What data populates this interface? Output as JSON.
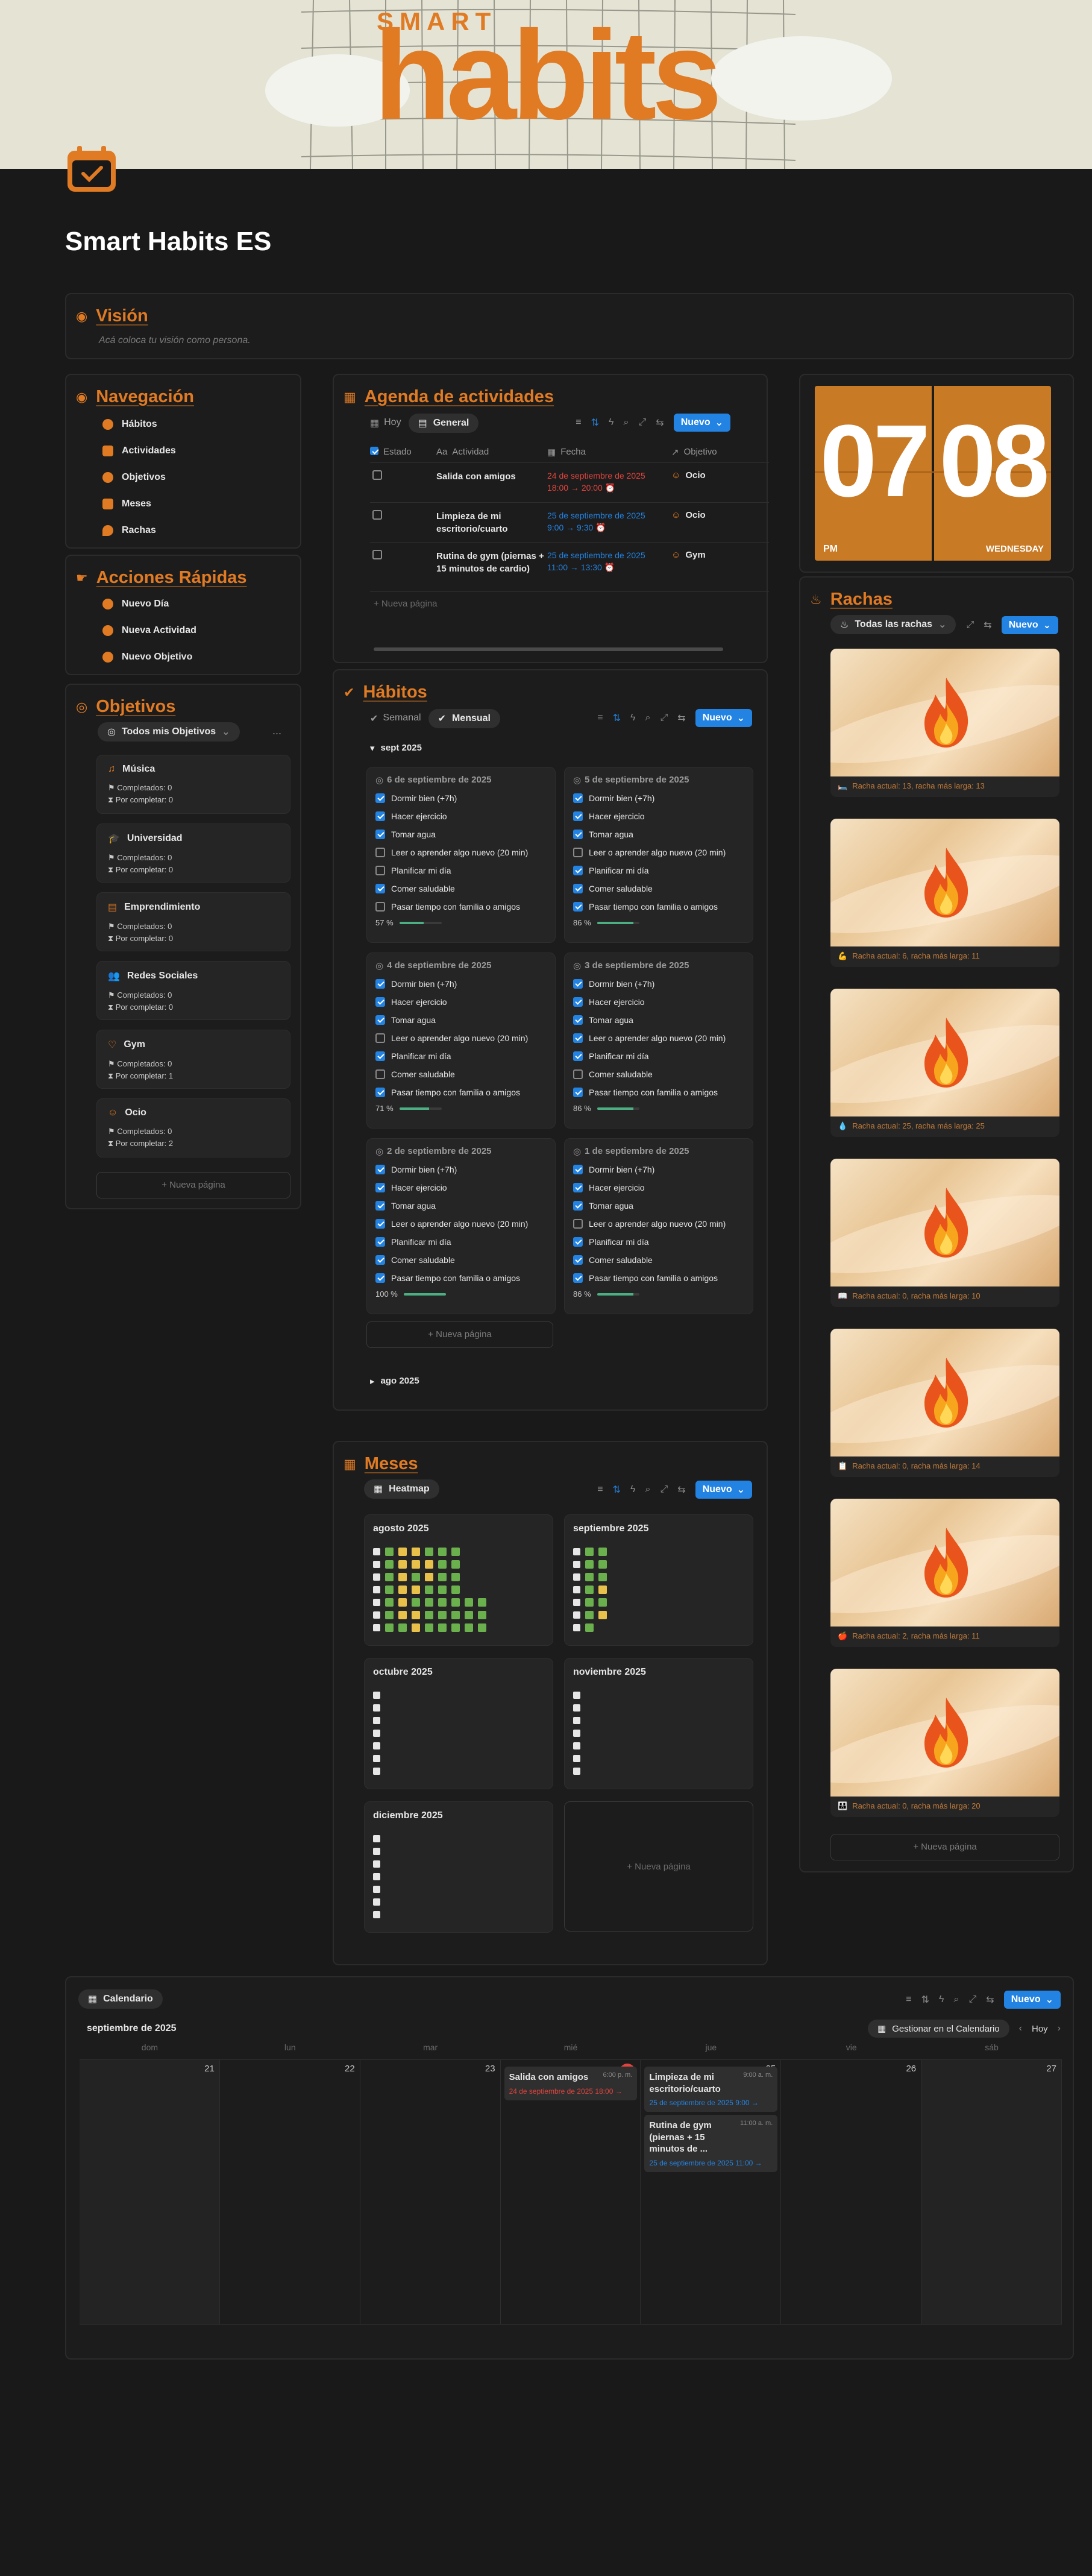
{
  "header": {
    "brand_small": "SMART",
    "brand_big": "habits"
  },
  "page": {
    "title": "Smart Habits ES"
  },
  "vision": {
    "title": "Visión",
    "placeholder": "Acá coloca tu visión como persona."
  },
  "nav": {
    "title": "Navegación",
    "items": [
      "Hábitos",
      "Actividades",
      "Objetivos",
      "Meses",
      "Rachas"
    ]
  },
  "quick": {
    "title": "Acciones Rápidas",
    "items": [
      "Nuevo Día",
      "Nueva Actividad",
      "Nuevo Objetivo"
    ]
  },
  "objectives": {
    "title": "Objetivos",
    "filter": "Todos mis Objetivos",
    "more": "...",
    "new_page": "+ Nueva página",
    "items": [
      {
        "name": "Música",
        "done": "Completados: 0",
        "todo": "Por completar: 0"
      },
      {
        "name": "Universidad",
        "done": "Completados: 0",
        "todo": "Por completar: 0"
      },
      {
        "name": "Emprendimiento",
        "done": "Completados: 0",
        "todo": "Por completar: 0"
      },
      {
        "name": "Redes Sociales",
        "done": "Completados: 0",
        "todo": "Por completar: 0"
      },
      {
        "name": "Gym",
        "done": "Completados: 0",
        "todo": "Por completar: 1"
      },
      {
        "name": "Ocio",
        "done": "Completados: 0",
        "todo": "Por completar: 2"
      }
    ]
  },
  "agenda": {
    "title": "Agenda de actividades",
    "tabs": [
      "Hoy",
      "General"
    ],
    "new": "Nuevo",
    "cols": [
      "Estado",
      "Actividad",
      "Fecha",
      "Objetivo"
    ],
    "rows": [
      {
        "activity": "Salida con amigos",
        "date": "24 de septiembre de 2025",
        "time": "18:00 → 20:00",
        "goal": "Ocio",
        "red": true
      },
      {
        "activity": "Limpieza de mi escritorio/cuarto",
        "date": "25 de septiembre de 2025",
        "time": "9:00 → 9:30",
        "goal": "Ocio",
        "red": false
      },
      {
        "activity": "Rutina de gym (piernas + 15 minutos de cardio)",
        "date": "25 de septiembre de 2025",
        "time": "11:00 → 13:30",
        "goal": "Gym",
        "red": false
      }
    ],
    "new_page": "+ Nueva página"
  },
  "clock": {
    "hour": "07",
    "minute": "08",
    "ampm": "PM",
    "day": "WEDNESDAY"
  },
  "rachas": {
    "title": "Rachas",
    "filter": "Todas las rachas",
    "new": "Nuevo",
    "new_page": "+ Nueva página",
    "items": [
      {
        "icon": "🛏️",
        "caption": "Racha actual: 13, racha más larga: 13"
      },
      {
        "icon": "💪",
        "caption": "Racha actual: 6, racha más larga: 11"
      },
      {
        "icon": "💧",
        "caption": "Racha actual: 25, racha más larga: 25"
      },
      {
        "icon": "📖",
        "caption": "Racha actual: 0, racha más larga: 10"
      },
      {
        "icon": "📋",
        "caption": "Racha actual: 0, racha más larga: 14"
      },
      {
        "icon": "🍎",
        "caption": "Racha actual: 2, racha más larga: 11"
      },
      {
        "icon": "👪",
        "caption": "Racha actual: 0, racha más larga: 20"
      }
    ]
  },
  "habits": {
    "title": "Hábitos",
    "tabs": [
      "Semanal",
      "Mensual"
    ],
    "new": "Nuevo",
    "group_open": "sept 2025",
    "group_closed": "ago 2025",
    "new_page": "+ Nueva página",
    "names": [
      "Dormir bien (+7h)",
      "Hacer ejercicio",
      "Tomar agua",
      "Leer o aprender algo nuevo (20 min)",
      "Planificar mi día",
      "Comer saludable",
      "Pasar tiempo con familia o amigos"
    ],
    "days": [
      {
        "title": "6 de septiembre de 2025",
        "checks": [
          1,
          1,
          1,
          0,
          0,
          1,
          0
        ],
        "pct": "57 %",
        "val": 0.57
      },
      {
        "title": "5 de septiembre de 2025",
        "checks": [
          1,
          1,
          1,
          0,
          1,
          1,
          1
        ],
        "pct": "86 %",
        "val": 0.86
      },
      {
        "title": "4 de septiembre de 2025",
        "checks": [
          1,
          1,
          1,
          0,
          1,
          0,
          1
        ],
        "pct": "71 %",
        "val": 0.71
      },
      {
        "title": "3 de septiembre de 2025",
        "checks": [
          1,
          1,
          1,
          1,
          1,
          0,
          1
        ],
        "pct": "86 %",
        "val": 0.86
      },
      {
        "title": "2 de septiembre de 2025",
        "checks": [
          1,
          1,
          1,
          1,
          1,
          1,
          1
        ],
        "pct": "100 %",
        "val": 1.0
      },
      {
        "title": "1 de septiembre de 2025",
        "checks": [
          1,
          1,
          1,
          0,
          1,
          1,
          1
        ],
        "pct": "86 %",
        "val": 0.86
      }
    ]
  },
  "months": {
    "title": "Meses",
    "view": "Heatmap",
    "new": "Nuevo",
    "new_page": "+ Nueva página",
    "items": [
      "agosto 2025",
      "septiembre 2025",
      "octubre 2025",
      "noviembre 2025",
      "diciembre 2025"
    ]
  },
  "calendar": {
    "view": "Calendario",
    "month": "septiembre de 2025",
    "manage": "Gestionar en el Calendario",
    "today": "Hoy",
    "new": "Nuevo",
    "weekdays": [
      "dom",
      "lun",
      "mar",
      "mié",
      "jue",
      "vie",
      "sáb"
    ],
    "days": [
      "21",
      "22",
      "23",
      "24",
      "25",
      "26",
      "27"
    ],
    "events": [
      {
        "title": "Salida con amigos",
        "time": "6:00 p. m.",
        "date": "24 de septiembre de 2025 18:00 →"
      },
      {
        "title": "Limpieza de mi escritorio/cuarto",
        "time": "9:00 a. m.",
        "date": "25 de septiembre de 2025 9:00 →"
      },
      {
        "title": "Rutina de gym (piernas + 15 minutos de ...",
        "time": "11:00 a. m.",
        "date": "25 de septiembre de 2025 11:00 →"
      }
    ]
  },
  "colors": {
    "accent": "#e07a23",
    "blue": "#2383e2",
    "green": "#4caf84",
    "red": "#e0443e",
    "yellow": "#e8c14a"
  }
}
